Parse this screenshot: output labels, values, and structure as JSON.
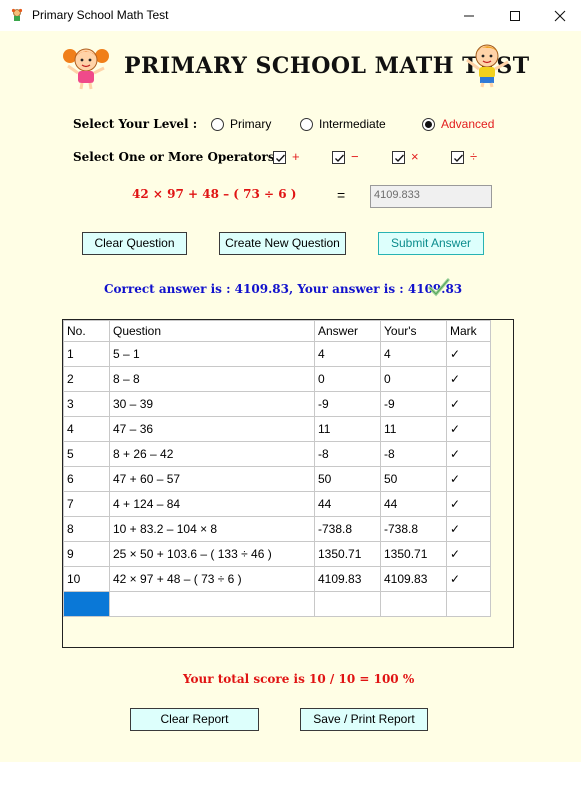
{
  "window": {
    "title": "Primary School Math Test"
  },
  "heading": "PRIMARY SCHOOL MATH TEST",
  "level": {
    "label": "Select Your Level :",
    "options": [
      {
        "label": "Primary",
        "selected": false
      },
      {
        "label": "Intermediate",
        "selected": false
      },
      {
        "label": "Advanced",
        "selected": true
      }
    ]
  },
  "operators": {
    "label": "Select One or More Operators :",
    "options": [
      {
        "symbol": "+",
        "checked": true
      },
      {
        "symbol": "−",
        "checked": true
      },
      {
        "symbol": "×",
        "checked": true
      },
      {
        "symbol": "÷",
        "checked": true
      }
    ]
  },
  "question": {
    "text": "42 × 97 + 48 –  ( 73 ÷ 6 )",
    "equals": "=",
    "answer_value": "4109.833"
  },
  "buttons": {
    "clear_question": "Clear Question",
    "create_question": "Create New Question",
    "submit_answer": "Submit Answer",
    "clear_report": "Clear Report",
    "save_print": "Save / Print Report"
  },
  "feedback": "Correct answer is : 4109.83,  Your answer is : 4109.83",
  "table": {
    "headers": [
      "No.",
      "Question",
      "Answer",
      "Your's",
      "Mark"
    ],
    "rows": [
      [
        "1",
        "5 – 1",
        "4",
        "4",
        "✓"
      ],
      [
        "2",
        "8 – 8",
        "0",
        "0",
        "✓"
      ],
      [
        "3",
        "30 – 39",
        "-9",
        "-9",
        "✓"
      ],
      [
        "4",
        "47 – 36",
        "11",
        "11",
        "✓"
      ],
      [
        "5",
        "8 + 26 – 42",
        "-8",
        "-8",
        "✓"
      ],
      [
        "6",
        "47 + 60 – 57",
        "50",
        "50",
        "✓"
      ],
      [
        "7",
        "4 + 124 – 84",
        "44",
        "44",
        "✓"
      ],
      [
        "8",
        "10 + 83.2 – 104 × 8",
        "-738.8",
        "-738.8",
        "✓"
      ],
      [
        "9",
        "25 × 50 + 103.6 –  ( 133 ÷ 46 )",
        "1350.71",
        "1350.71",
        "✓"
      ],
      [
        "10",
        "42 × 97 + 48 –  ( 73 ÷ 6 )",
        "4109.83",
        "4109.83",
        "✓"
      ]
    ]
  },
  "score": "Your total score is 10 / 10 = 100 %",
  "colors": {
    "background": "#fffee5",
    "accent_red": "#e01313",
    "accent_blue": "#1111cc",
    "button_bg": "#ddfffc",
    "selection": "#0a78d7"
  }
}
